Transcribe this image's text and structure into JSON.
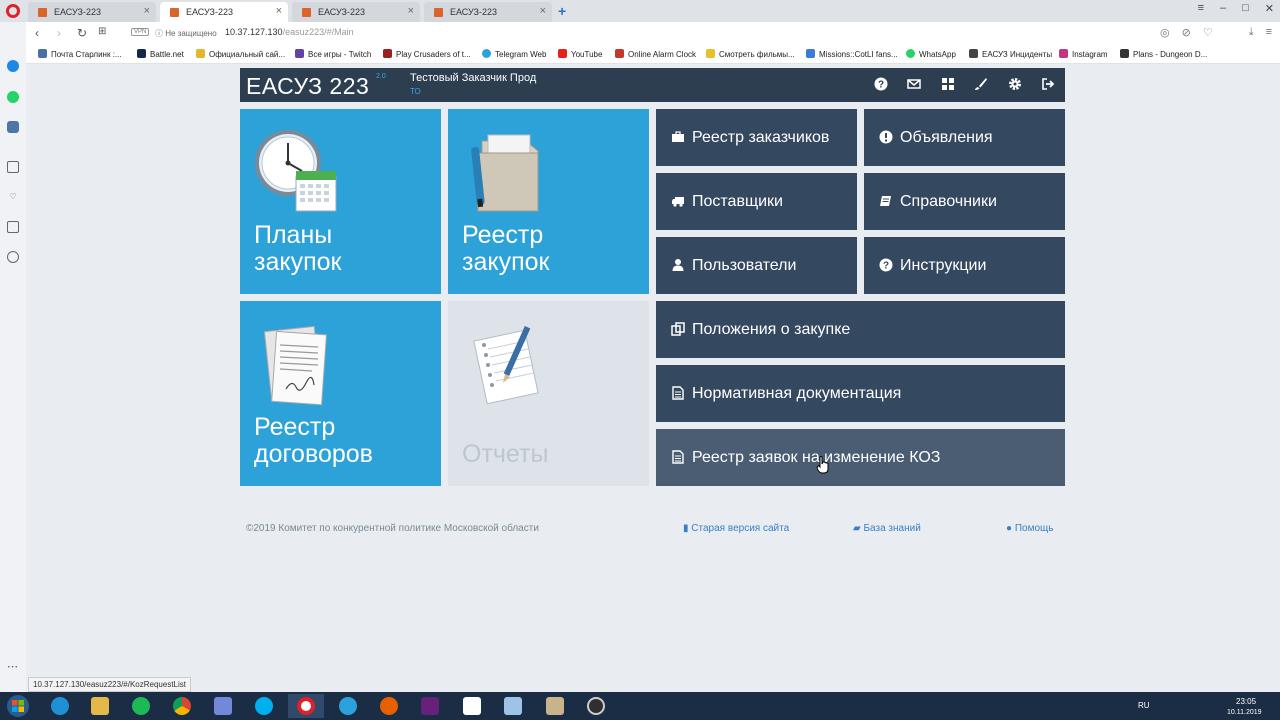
{
  "browser": {
    "tabs": [
      {
        "title": "ЕАСУЗ-223"
      },
      {
        "title": "ЕАСУЗ-223"
      },
      {
        "title": "ЕАСУЗ-223"
      },
      {
        "title": "ЕАСУЗ-223"
      }
    ],
    "vpn_label": "VPN",
    "security_label": "Не защищено",
    "url_host": "10.37.127.130",
    "url_path": "/easuz223/#/Main",
    "bookmarks": [
      {
        "label": "Почта Старлинк :...",
        "color": "#4a6fa5"
      },
      {
        "label": "Battle.net",
        "color": "#13294b"
      },
      {
        "label": "Официальный сай...",
        "color": "#e5b52b"
      },
      {
        "label": "Все игры - Twitch",
        "color": "#6441a5"
      },
      {
        "label": "Play Crusaders of t...",
        "color": "#9a1f1f"
      },
      {
        "label": "Telegram Web",
        "color": "#2aa3dd"
      },
      {
        "label": "YouTube",
        "color": "#e62117"
      },
      {
        "label": "Online Alarm Clock",
        "color": "#c0392b"
      },
      {
        "label": "Смотреть фильмы...",
        "color": "#e5c12b"
      },
      {
        "label": "Missions::CotLI fans...",
        "color": "#3a7bd5"
      },
      {
        "label": "WhatsApp",
        "color": "#25d366"
      },
      {
        "label": "ЕАСУЗ Инциденты",
        "color": "#444444"
      },
      {
        "label": "Instagram",
        "color": "#c13584"
      },
      {
        "label": "Plans - Dungeon D...",
        "color": "#333333"
      }
    ]
  },
  "app": {
    "logo": "ЕАСУЗ 223",
    "version": "2.0",
    "customer": "Тестовый Заказчик Прод",
    "customer_sub": "ТО",
    "header_icons": [
      "help-icon",
      "mail-icon",
      "grid-icon",
      "brush-icon",
      "settings-icon",
      "logout-icon"
    ]
  },
  "tiles": {
    "plans": "Планы закупок",
    "registry": "Реестр закупок",
    "contracts": "Реестр договоров",
    "reports": "Отчеты"
  },
  "menu": {
    "customers": "Реестр заказчиков",
    "announcements": "Объявления",
    "suppliers": "Поставщики",
    "directories": "Справочники",
    "users": "Пользователи",
    "instructions": "Инструкции",
    "regulations": "Положения о закупке",
    "normative": "Нормативная документация",
    "koz_requests": "Реестр заявок на изменение КОЗ"
  },
  "footer": {
    "copyright": "©2019 Комитет по конкурентной политике Московской области",
    "old_version": "Старая версия сайта",
    "knowledge": "База знаний",
    "help": "Помощь"
  },
  "status_url": "10.37.127.130/easuz223/#/KozRequestList",
  "taskbar": {
    "lang": "RU",
    "time": "23:05",
    "date": "10.11.2019"
  },
  "colors": {
    "tile_blue": "#2da2d8",
    "menu_dark": "#344860",
    "header_dark": "#2c3e50",
    "disabled_tile": "#dde3e8"
  }
}
